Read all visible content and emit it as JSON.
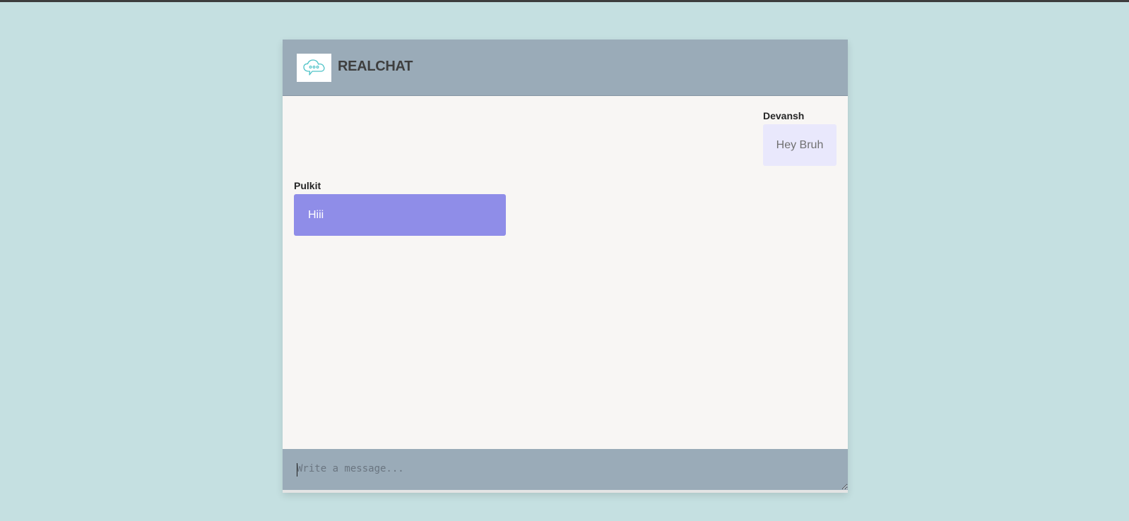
{
  "app": {
    "title": "REALCHAT"
  },
  "messages": [
    {
      "sender": "Devansh",
      "text": "Hey Bruh",
      "align": "right"
    },
    {
      "sender": "Pulkit",
      "text": "Hiii",
      "align": "left"
    }
  ],
  "composer": {
    "value": "",
    "placeholder": "Write a message..."
  },
  "colors": {
    "page_background": "#c5e0e1",
    "header_background": "#9aabb8",
    "chat_background": "#f8f6f4",
    "incoming_bubble": "#e9e8fc",
    "outgoing_bubble": "#8f8de8"
  },
  "icons": {
    "logo": "chat-cloud-icon"
  }
}
